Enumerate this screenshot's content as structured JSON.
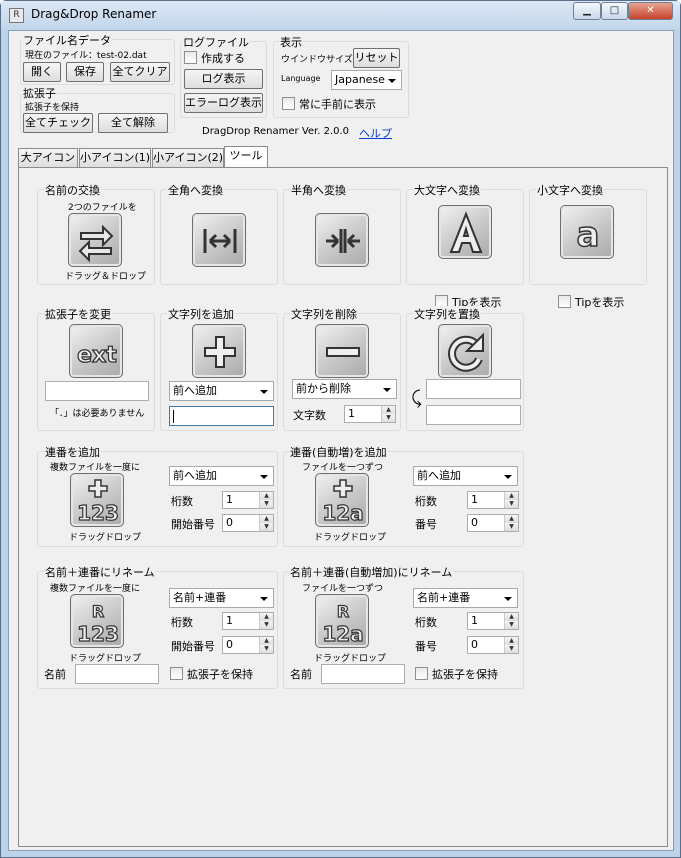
{
  "window": {
    "title": "Drag&Drop Renamer",
    "min": "▁",
    "max": "□",
    "close": "✕",
    "app_icon": "R"
  },
  "filename_data": {
    "group_label": "ファイル名データ",
    "current_file": "現在のファイル：test-02.dat",
    "open": "開く",
    "save": "保存",
    "clear_all": "全てクリア"
  },
  "extension": {
    "group_label": "拡張子",
    "keep": "拡張子を保持",
    "check_all": "全てチェック",
    "uncheck_all": "全て解除"
  },
  "log": {
    "group_label": "ログファイル",
    "create": "作成する",
    "show_log": "ログ表示",
    "show_error_log": "エラーログ表示"
  },
  "display": {
    "group_label": "表示",
    "window_size": "ウインドウサイズ",
    "reset": "リセット",
    "language_label": "Language",
    "language_value": "Japanese",
    "always_on_top": "常に手前に表示"
  },
  "version": "DragDrop Renamer Ver. 2.0.0",
  "help": "ヘルプ",
  "tabs": [
    "大アイコン",
    "小アイコン(1)",
    "小アイコン(2)",
    "ツール"
  ],
  "tools": {
    "swap": {
      "label": "名前の交換",
      "top": "2つのファイルを",
      "bottom": "ドラッグ＆ドロップ"
    },
    "zenkaku": {
      "label": "全角へ変換"
    },
    "hankaku": {
      "label": "半角へ変換"
    },
    "upper": {
      "label": "大文字へ変換",
      "tip": "Tipを表示"
    },
    "lower": {
      "label": "小文字へ変換",
      "tip": "Tipを表示"
    },
    "ext_change": {
      "label": "拡張子を変更",
      "note": "「．」は必要ありません",
      "icon_text": "ext"
    },
    "add_str": {
      "label": "文字列を追加",
      "select": "前へ追加"
    },
    "del_str": {
      "label": "文字列を削除",
      "select": "前から削除",
      "count_label": "文字数",
      "count": "1"
    },
    "replace": {
      "label": "文字列を置換"
    },
    "seq": {
      "label": "連番を追加",
      "top": "複数ファイルを一度に",
      "bottom": "ドラッグドロップ",
      "icon_text": "123",
      "select": "前へ追加",
      "digits_label": "桁数",
      "digits": "1",
      "start_label": "開始番号",
      "start": "0"
    },
    "seq_auto": {
      "label": "連番(自動増)を追加",
      "top": "ファイルを一つずつ",
      "bottom": "ドラッグドロップ",
      "icon_text": "12a",
      "select": "前へ追加",
      "digits_label": "桁数",
      "digits": "1",
      "num_label": "番号",
      "num": "0"
    },
    "rename_seq": {
      "label": "名前＋連番にリネーム",
      "top": "複数ファイルを一度に",
      "bottom": "ドラッグドロップ",
      "icon_text": "123",
      "select": "名前+連番",
      "digits_label": "桁数",
      "digits": "1",
      "start_label": "開始番号",
      "start": "0",
      "name_label": "名前",
      "keep_ext": "拡張子を保持"
    },
    "rename_seq_auto": {
      "label": "名前＋連番(自動増加)にリネーム",
      "top": "ファイルを一つずつ",
      "bottom": "ドラッグドロップ",
      "icon_text": "12a",
      "select": "名前+連番",
      "digits_label": "桁数",
      "digits": "1",
      "num_label": "番号",
      "num": "0",
      "name_label": "名前",
      "keep_ext": "拡張子を保持"
    }
  },
  "colors": {
    "title_bg": "#c3d6eb",
    "client_bg": "#f0f0f0",
    "link": "#0a3bd2",
    "close_btn": "#c4432b"
  }
}
